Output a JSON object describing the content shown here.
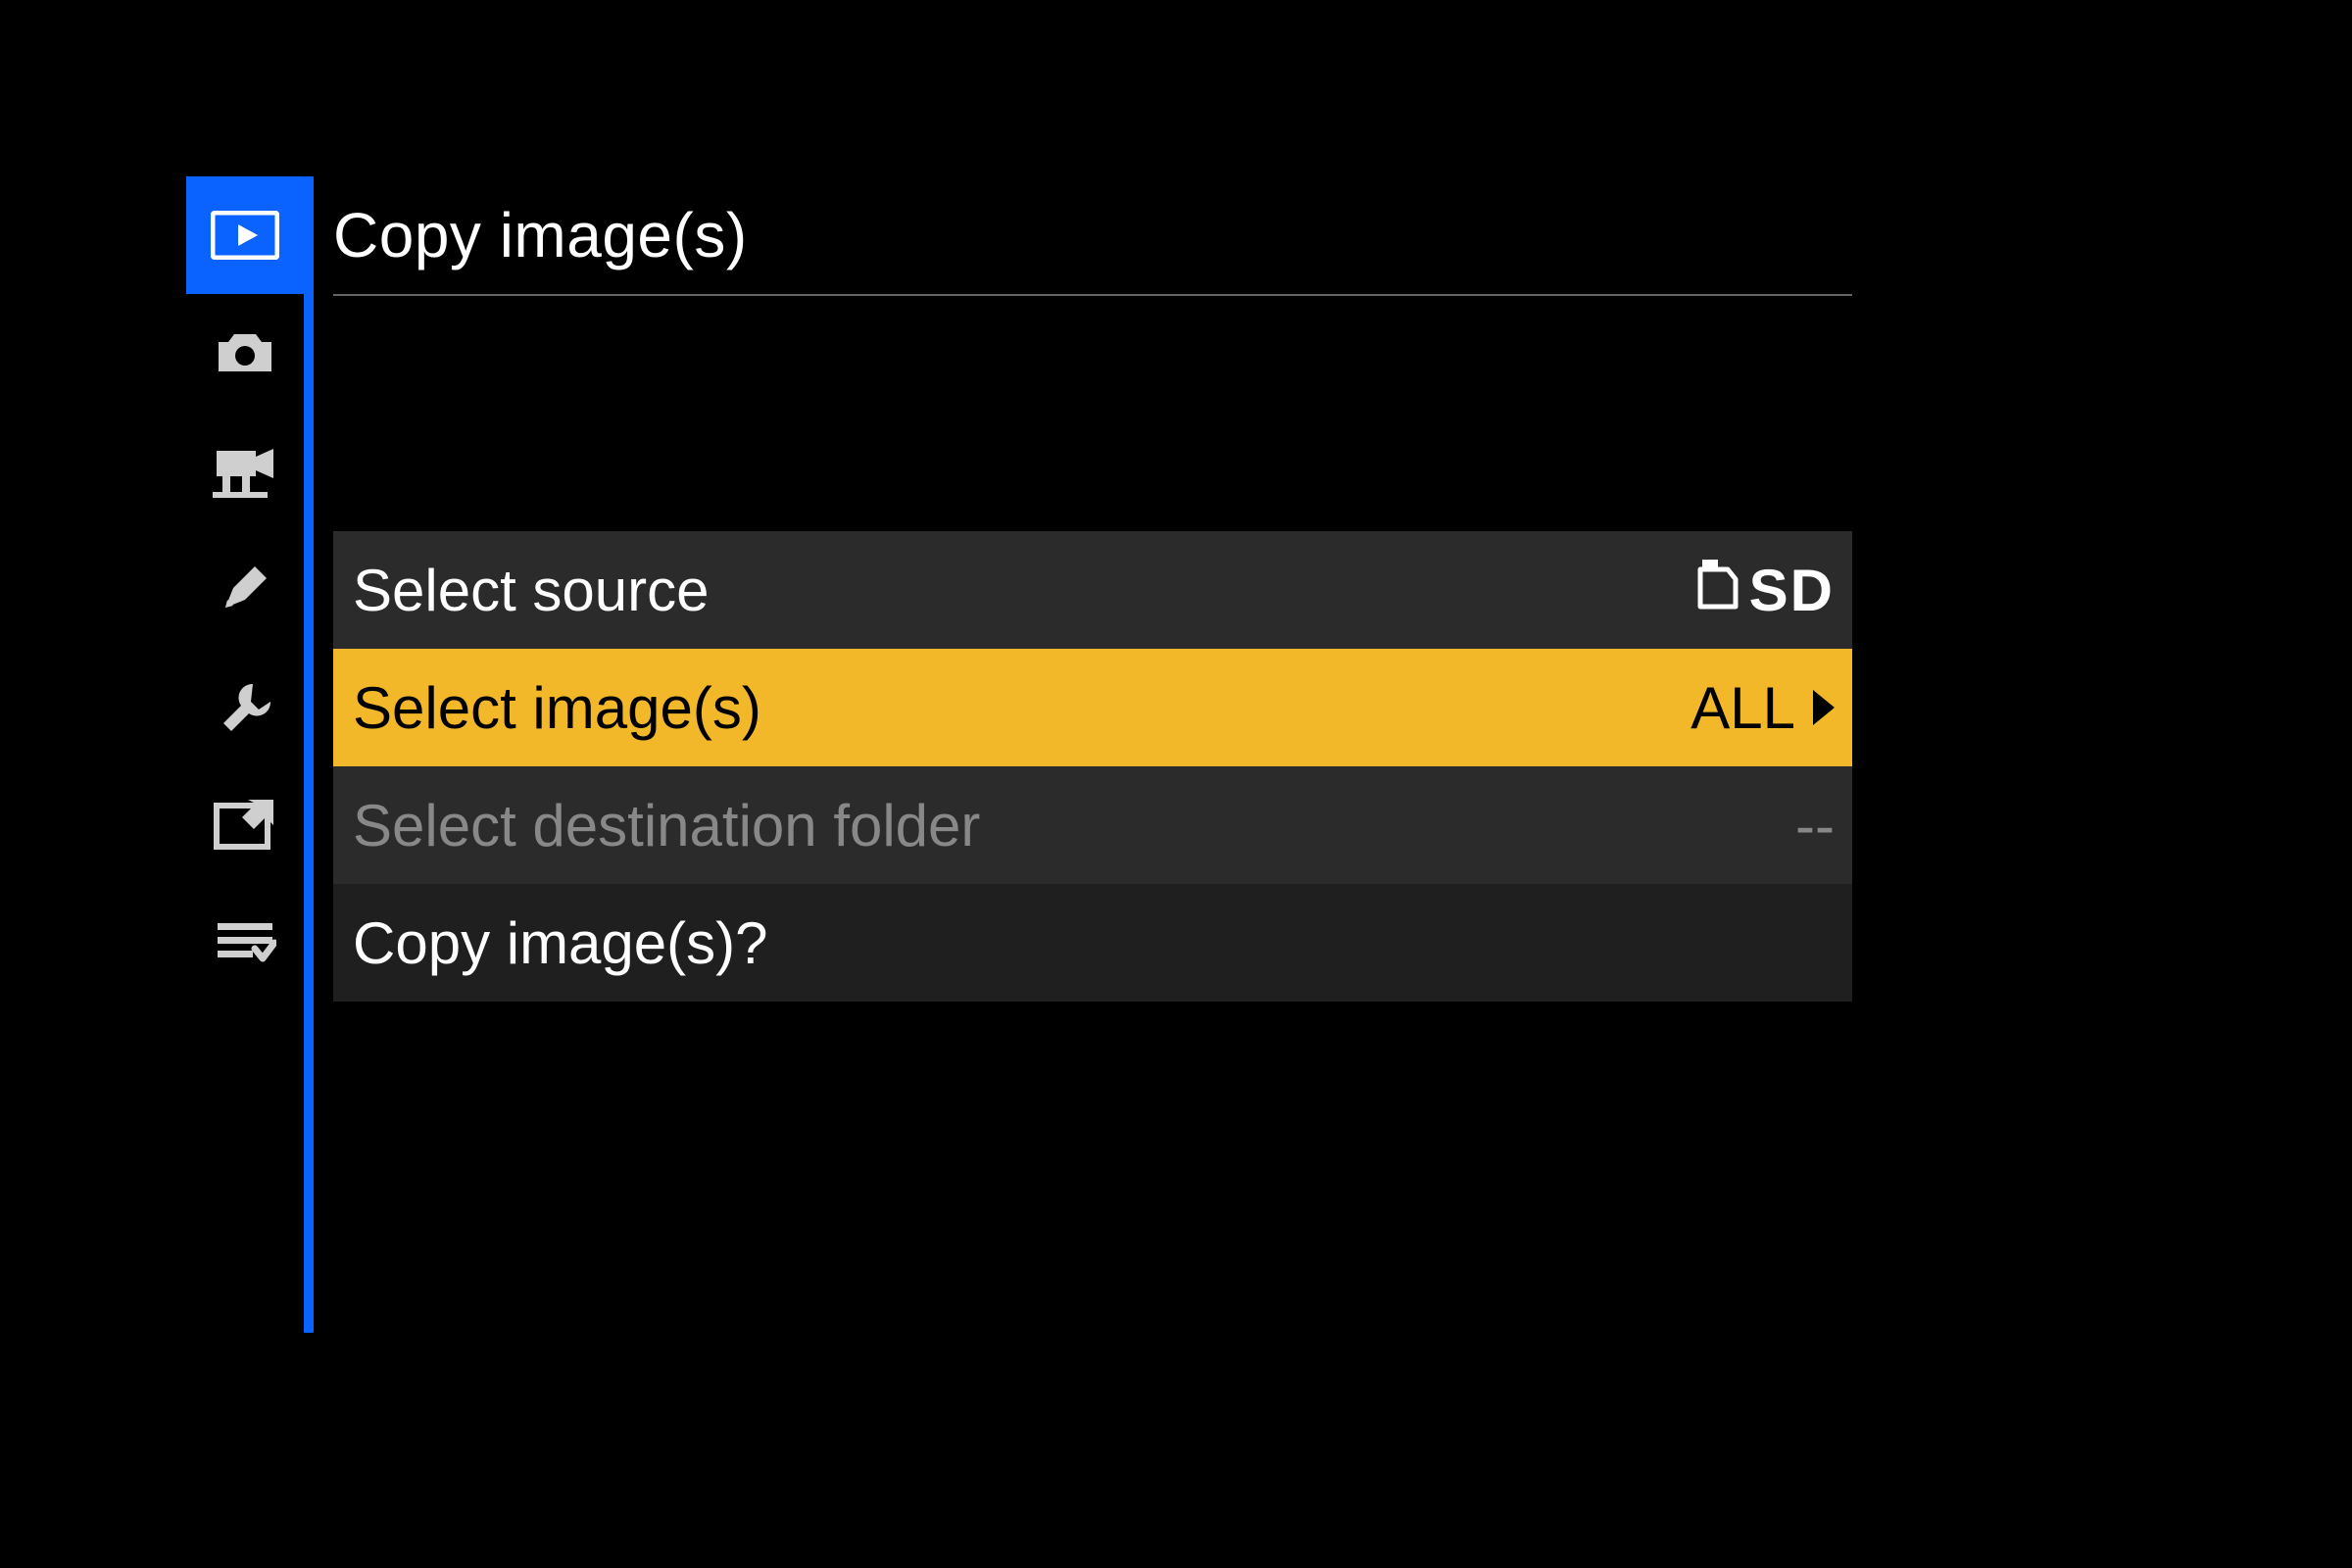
{
  "header": {
    "title": "Copy image(s)"
  },
  "tabs": [
    {
      "name": "playback",
      "active": true
    },
    {
      "name": "photo",
      "active": false
    },
    {
      "name": "video",
      "active": false
    },
    {
      "name": "edit-pencil",
      "active": false
    },
    {
      "name": "setup-wrench",
      "active": false
    },
    {
      "name": "retouch",
      "active": false
    },
    {
      "name": "my-menu",
      "active": false
    }
  ],
  "rows": [
    {
      "label": "Select source",
      "value": "SD",
      "value_type": "sd",
      "state": "normal"
    },
    {
      "label": "Select image(s)",
      "value": "ALL",
      "value_type": "arrow",
      "state": "selected"
    },
    {
      "label": "Select destination folder",
      "value": "--",
      "value_type": "text",
      "state": "disabled"
    },
    {
      "label": "Copy image(s)?",
      "value": "",
      "value_type": "text",
      "state": "normal"
    }
  ],
  "colors": {
    "accent": "#0a63ff",
    "highlight": "#f3b82a",
    "bg": "#000000"
  }
}
